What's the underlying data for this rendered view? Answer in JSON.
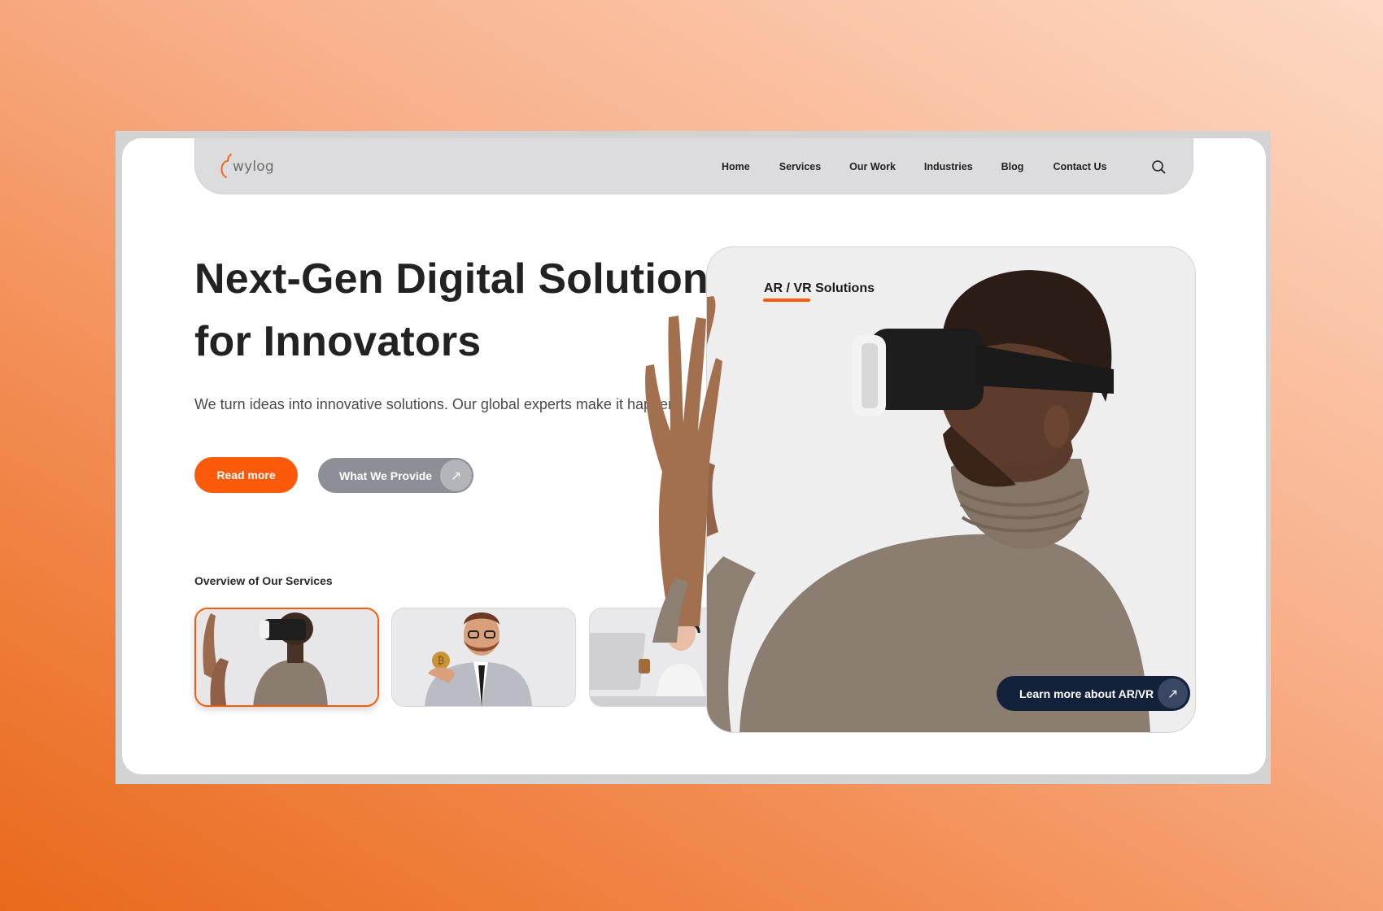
{
  "brand": {
    "name": "wylog",
    "accent": "#fb5a0a"
  },
  "nav": {
    "items": [
      "Home",
      "Services",
      "Our Work",
      "Industries",
      "Blog",
      "Contact Us"
    ],
    "search_icon": "search-icon"
  },
  "hero": {
    "headline_line1": "Next-Gen Digital Solutions",
    "headline_line2": "for Innovators",
    "subtitle": "We turn ideas into innovative solutions.  Our global experts make it happen.",
    "primary_cta": "Read more",
    "secondary_cta": "What We Provide",
    "secondary_cta_icon": "arrow-up-right-icon"
  },
  "overview": {
    "label": "Overview of Our Services",
    "thumbnails": [
      {
        "subject": "man-vr-headset",
        "active": true
      },
      {
        "subject": "man-holding-bitcoin",
        "active": false
      },
      {
        "subject": "woman-headset-support",
        "active": false
      }
    ]
  },
  "feature": {
    "title": "AR / VR Solutions",
    "cta": "Learn more about AR/VR",
    "cta_icon": "arrow-up-right-icon",
    "colors": {
      "cta_bg": "#13213a",
      "panel_bg": "#eeeeef"
    }
  }
}
